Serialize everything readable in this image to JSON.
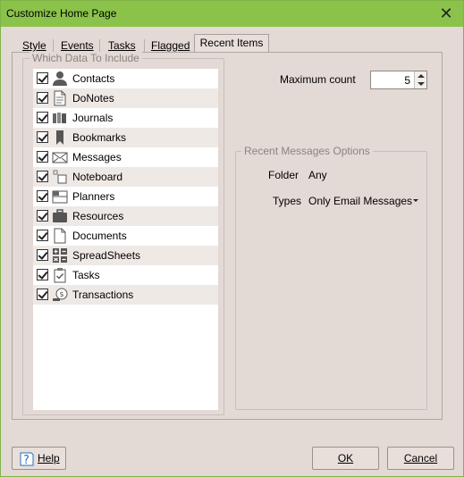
{
  "window": {
    "title": "Customize Home Page"
  },
  "tabs": [
    {
      "label": "Style",
      "active": false
    },
    {
      "label": "Events",
      "active": false
    },
    {
      "label": "Tasks",
      "active": false
    },
    {
      "label": "Flagged",
      "active": false
    },
    {
      "label": "Recent Items",
      "active": true
    }
  ],
  "data_group": {
    "title": "Which Data To Include",
    "items": [
      {
        "label": "Contacts",
        "checked": true,
        "icon": "person-icon"
      },
      {
        "label": "DoNotes",
        "checked": true,
        "icon": "note-page-icon"
      },
      {
        "label": "Journals",
        "checked": true,
        "icon": "books-icon"
      },
      {
        "label": "Bookmarks",
        "checked": true,
        "icon": "bookmark-icon"
      },
      {
        "label": "Messages",
        "checked": true,
        "icon": "envelope-icon"
      },
      {
        "label": "Noteboard",
        "checked": true,
        "icon": "noteboard-icon"
      },
      {
        "label": "Planners",
        "checked": true,
        "icon": "planner-icon"
      },
      {
        "label": "Resources",
        "checked": true,
        "icon": "briefcase-icon"
      },
      {
        "label": "Documents",
        "checked": true,
        "icon": "document-icon"
      },
      {
        "label": "SpreadSheets",
        "checked": true,
        "icon": "spreadsheet-icon"
      },
      {
        "label": "Tasks",
        "checked": true,
        "icon": "clipboard-icon"
      },
      {
        "label": "Transactions",
        "checked": true,
        "icon": "transaction-icon"
      }
    ]
  },
  "maximum": {
    "label": "Maximum count",
    "value": "5"
  },
  "recent_options": {
    "title": "Recent Messages Options",
    "folder_label": "Folder",
    "folder_value": "Any",
    "types_label": "Types",
    "types_value": "Only Email Messages"
  },
  "buttons": {
    "help": "Help",
    "ok": "OK",
    "cancel": "Cancel"
  },
  "colors": {
    "titlebar": "#8bc34a",
    "dialog": "#e3d9d5",
    "list_alt": "#efe9e6"
  }
}
